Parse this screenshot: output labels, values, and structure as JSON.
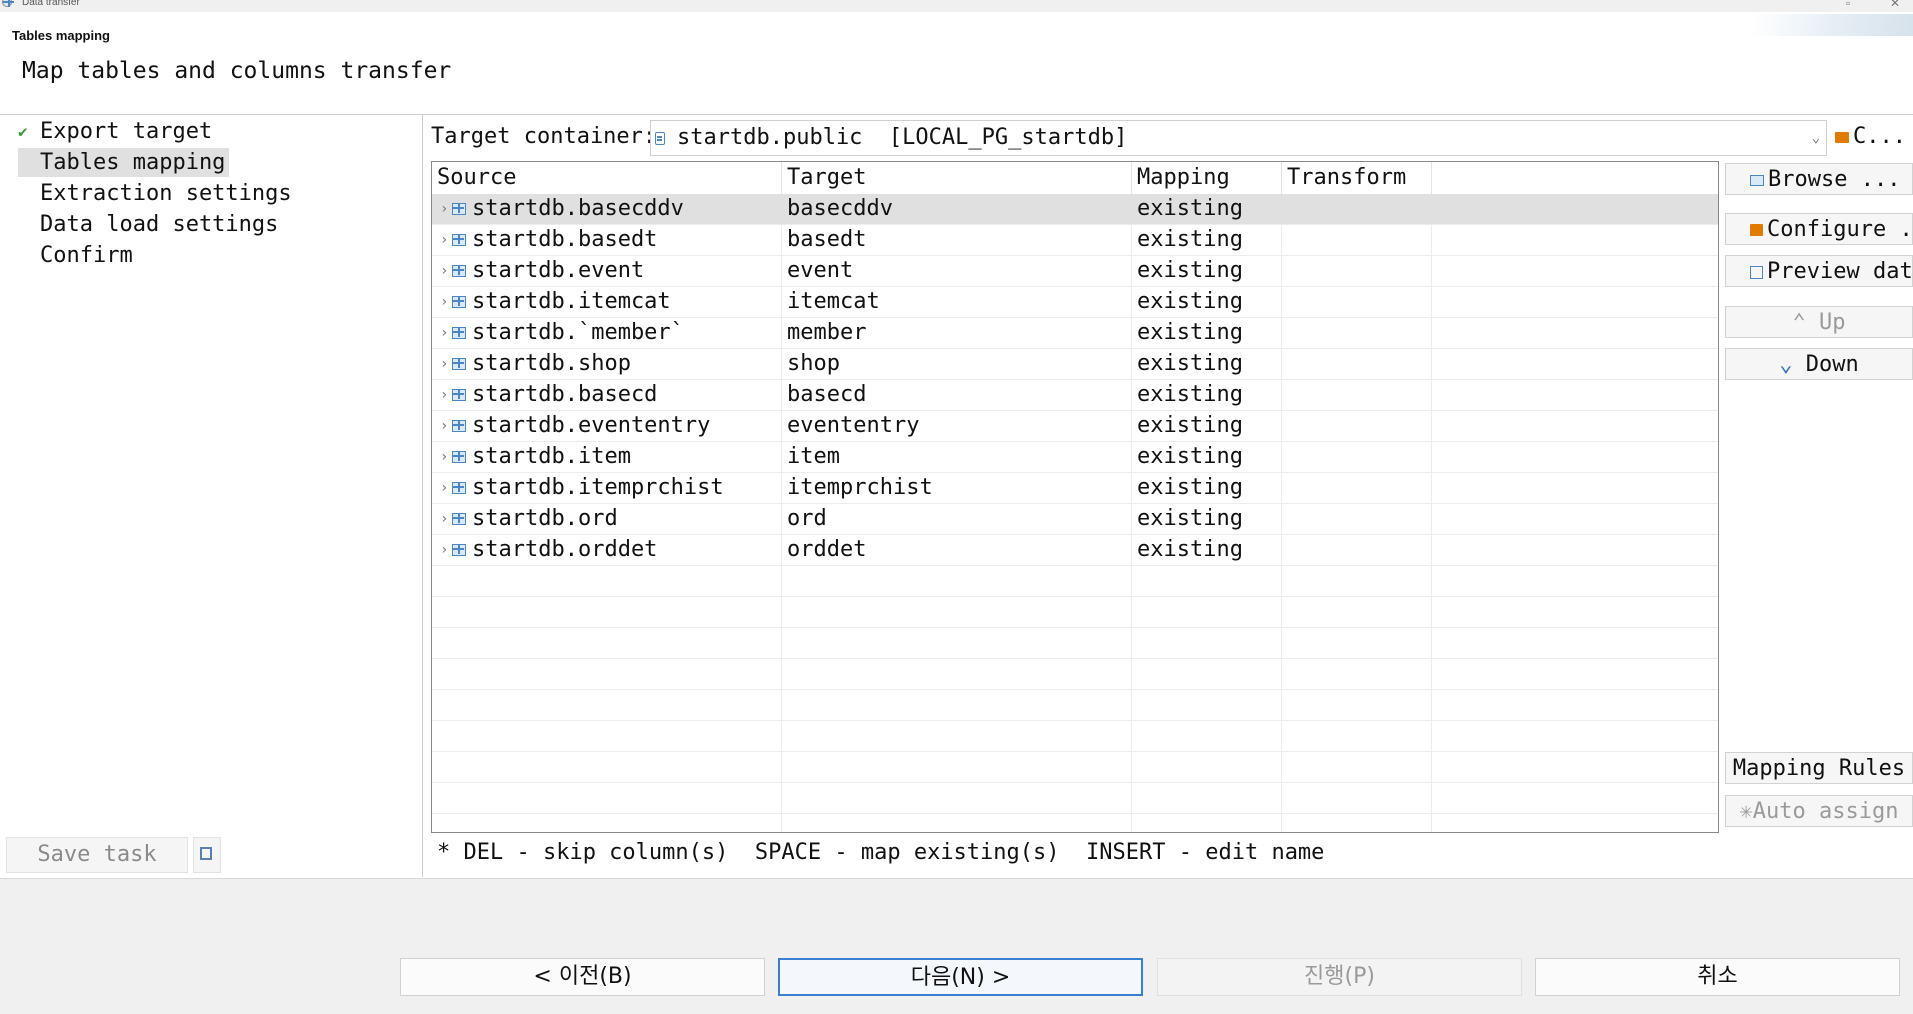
{
  "window": {
    "title": "Data transfer"
  },
  "header": {
    "title": "Tables mapping",
    "description": "Map tables and columns transfer"
  },
  "steps": [
    {
      "label": "Export target",
      "done": true
    },
    {
      "label": "Tables mapping",
      "active": true
    },
    {
      "label": "Extraction settings"
    },
    {
      "label": "Data load settings"
    },
    {
      "label": "Confirm"
    }
  ],
  "save_task": {
    "label": "Save task"
  },
  "target_container": {
    "label": "Target container:",
    "value": "startdb.public  [LOCAL_PG_startdb]",
    "choose_label": "C..."
  },
  "table": {
    "columns": [
      "Source",
      "Target",
      "Mapping",
      "Transform"
    ],
    "rows": [
      {
        "source": "startdb.basecddv",
        "target": "basecddv",
        "mapping": "existing"
      },
      {
        "source": "startdb.basedt",
        "target": "basedt",
        "mapping": "existing"
      },
      {
        "source": "startdb.event",
        "target": "event",
        "mapping": "existing"
      },
      {
        "source": "startdb.itemcat",
        "target": "itemcat",
        "mapping": "existing"
      },
      {
        "source": "startdb.`member`",
        "target": "member",
        "mapping": "existing"
      },
      {
        "source": "startdb.shop",
        "target": "shop",
        "mapping": "existing"
      },
      {
        "source": "startdb.basecd",
        "target": "basecd",
        "mapping": "existing"
      },
      {
        "source": "startdb.evententry",
        "target": "evententry",
        "mapping": "existing"
      },
      {
        "source": "startdb.item",
        "target": "item",
        "mapping": "existing"
      },
      {
        "source": "startdb.itemprchist",
        "target": "itemprchist",
        "mapping": "existing"
      },
      {
        "source": "startdb.ord",
        "target": "ord",
        "mapping": "existing"
      },
      {
        "source": "startdb.orddet",
        "target": "orddet",
        "mapping": "existing"
      }
    ]
  },
  "side_buttons": {
    "browse": "Browse ...",
    "configure": "Configure ...",
    "preview": "Preview data",
    "up": "Up",
    "down": "Down",
    "mapping_rules": "Mapping Rules",
    "auto_assign": "Auto assign"
  },
  "hint": "* DEL - skip column(s)  SPACE - map existing(s)  INSERT - edit name",
  "footer": {
    "back": "< 이전(B)",
    "next": "다음(N) >",
    "proceed": "진행(P)",
    "cancel": "취소"
  }
}
